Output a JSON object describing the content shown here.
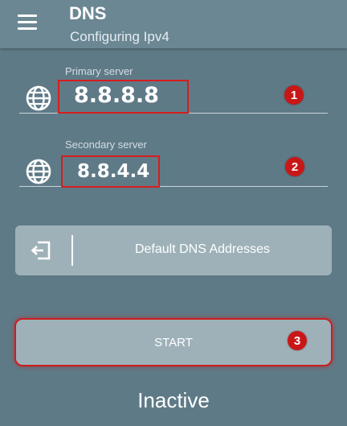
{
  "appbar": {
    "title": "DNS",
    "subtitle": "Configuring Ipv4"
  },
  "primary": {
    "label": "Primary server",
    "value": "8.8.8.8",
    "marker": "1"
  },
  "secondary": {
    "label": "Secondary server",
    "value": "8.8.4.4",
    "marker": "2"
  },
  "default_button": {
    "label": "Default DNS Addresses"
  },
  "start_button": {
    "label": "START",
    "marker": "3"
  },
  "status": "Inactive",
  "colors": {
    "background": "#5f7a87",
    "appbar": "#6b8794",
    "button": "#9eb1b9",
    "highlight": "#d61d1d"
  },
  "icons": {
    "menu": "hamburger-menu-icon",
    "globe": "globe-icon",
    "exit": "exit-icon"
  }
}
